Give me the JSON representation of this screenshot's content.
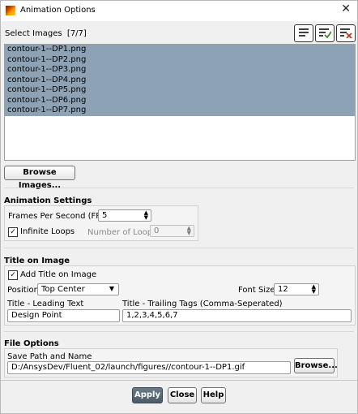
{
  "window": {
    "title": "Animation Options",
    "close_glyph": "✕"
  },
  "select_images": {
    "label": "Select Images",
    "count": "[7/7]",
    "items": [
      "contour-1--DP1.png",
      "contour-1--DP2.png",
      "contour-1--DP3.png",
      "contour-1--DP4.png",
      "contour-1--DP5.png",
      "contour-1--DP6.png",
      "contour-1--DP7.png"
    ],
    "browse_label": "Browse Images..."
  },
  "animation_settings": {
    "heading": "Animation Settings",
    "fps_label": "Frames Per Second (FPS)",
    "fps_value": "5",
    "infinite_loops_label": "Infinite Loops",
    "infinite_loops_checked": true,
    "loops_label": "Number of Loops",
    "loops_value": "0"
  },
  "title_on_image": {
    "heading": "Title on Image",
    "add_title_label": "Add Title on Image",
    "add_title_checked": true,
    "position_label": "Position",
    "position_value": "Top Center",
    "font_size_label": "Font Size",
    "font_size_value": "12",
    "leading_label": "Title - Leading Text",
    "leading_value": "Design Point",
    "trailing_label": "Title - Trailing Tags (Comma-Seperated)",
    "trailing_value": "1,2,3,4,5,6,7"
  },
  "file_options": {
    "heading": "File Options",
    "save_label": "Save Path and Name",
    "save_value": "D:/AnsysDev/Fluent_02/launch/figures//contour-1--DP1.gif",
    "browse_label": "Browse..."
  },
  "footer": {
    "apply": "Apply",
    "close": "Close",
    "help": "Help"
  },
  "colors": {
    "selection": "#8da2b5",
    "primary_button": "#5a6875"
  },
  "icons": [
    "app-icon",
    "list-icon",
    "select-all-icon",
    "deselect-icon"
  ]
}
